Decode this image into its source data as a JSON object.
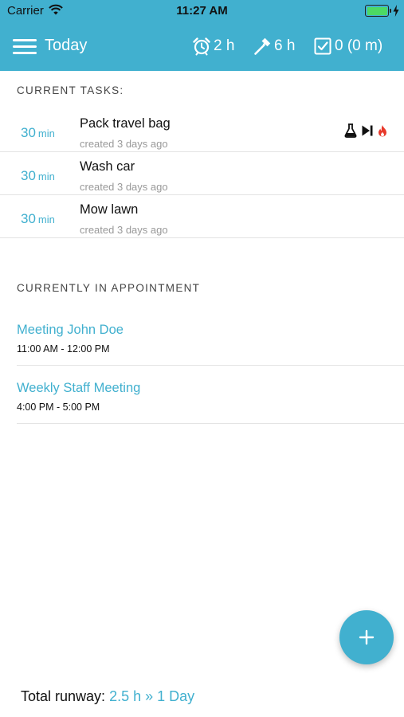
{
  "status_bar": {
    "carrier": "Carrier",
    "time": "11:27 AM"
  },
  "nav": {
    "title": "Today",
    "stats": {
      "alarm": "2 h",
      "hammer": "6 h",
      "done": "0 (0 m)"
    }
  },
  "tasks": {
    "heading": "CURRENT TASKS:",
    "items": [
      {
        "duration": "30",
        "unit": "min",
        "title": "Pack travel bag",
        "created": "created 3 days ago",
        "icons": [
          "flask-icon",
          "skip-next-icon",
          "flame-icon"
        ]
      },
      {
        "duration": "30",
        "unit": "min",
        "title": "Wash car",
        "created": "created 3 days ago",
        "icons": []
      },
      {
        "duration": "30",
        "unit": "min",
        "title": "Mow lawn",
        "created": "created 3 days ago",
        "icons": []
      }
    ]
  },
  "appointments": {
    "heading": "CURRENTLY IN APPOINTMENT",
    "items": [
      {
        "title": "Meeting John Doe",
        "time": "11:00 AM - 12:00 PM"
      },
      {
        "title": "Weekly Staff Meeting",
        "time": "4:00 PM - 5:00 PM"
      }
    ]
  },
  "footer": {
    "label": "Total runway:",
    "value": "2.5 h » 1 Day"
  },
  "fab": {
    "icon": "plus-icon"
  },
  "colors": {
    "accent": "#41b0cf",
    "battery": "#4cd964",
    "flame": "#e8392b"
  }
}
